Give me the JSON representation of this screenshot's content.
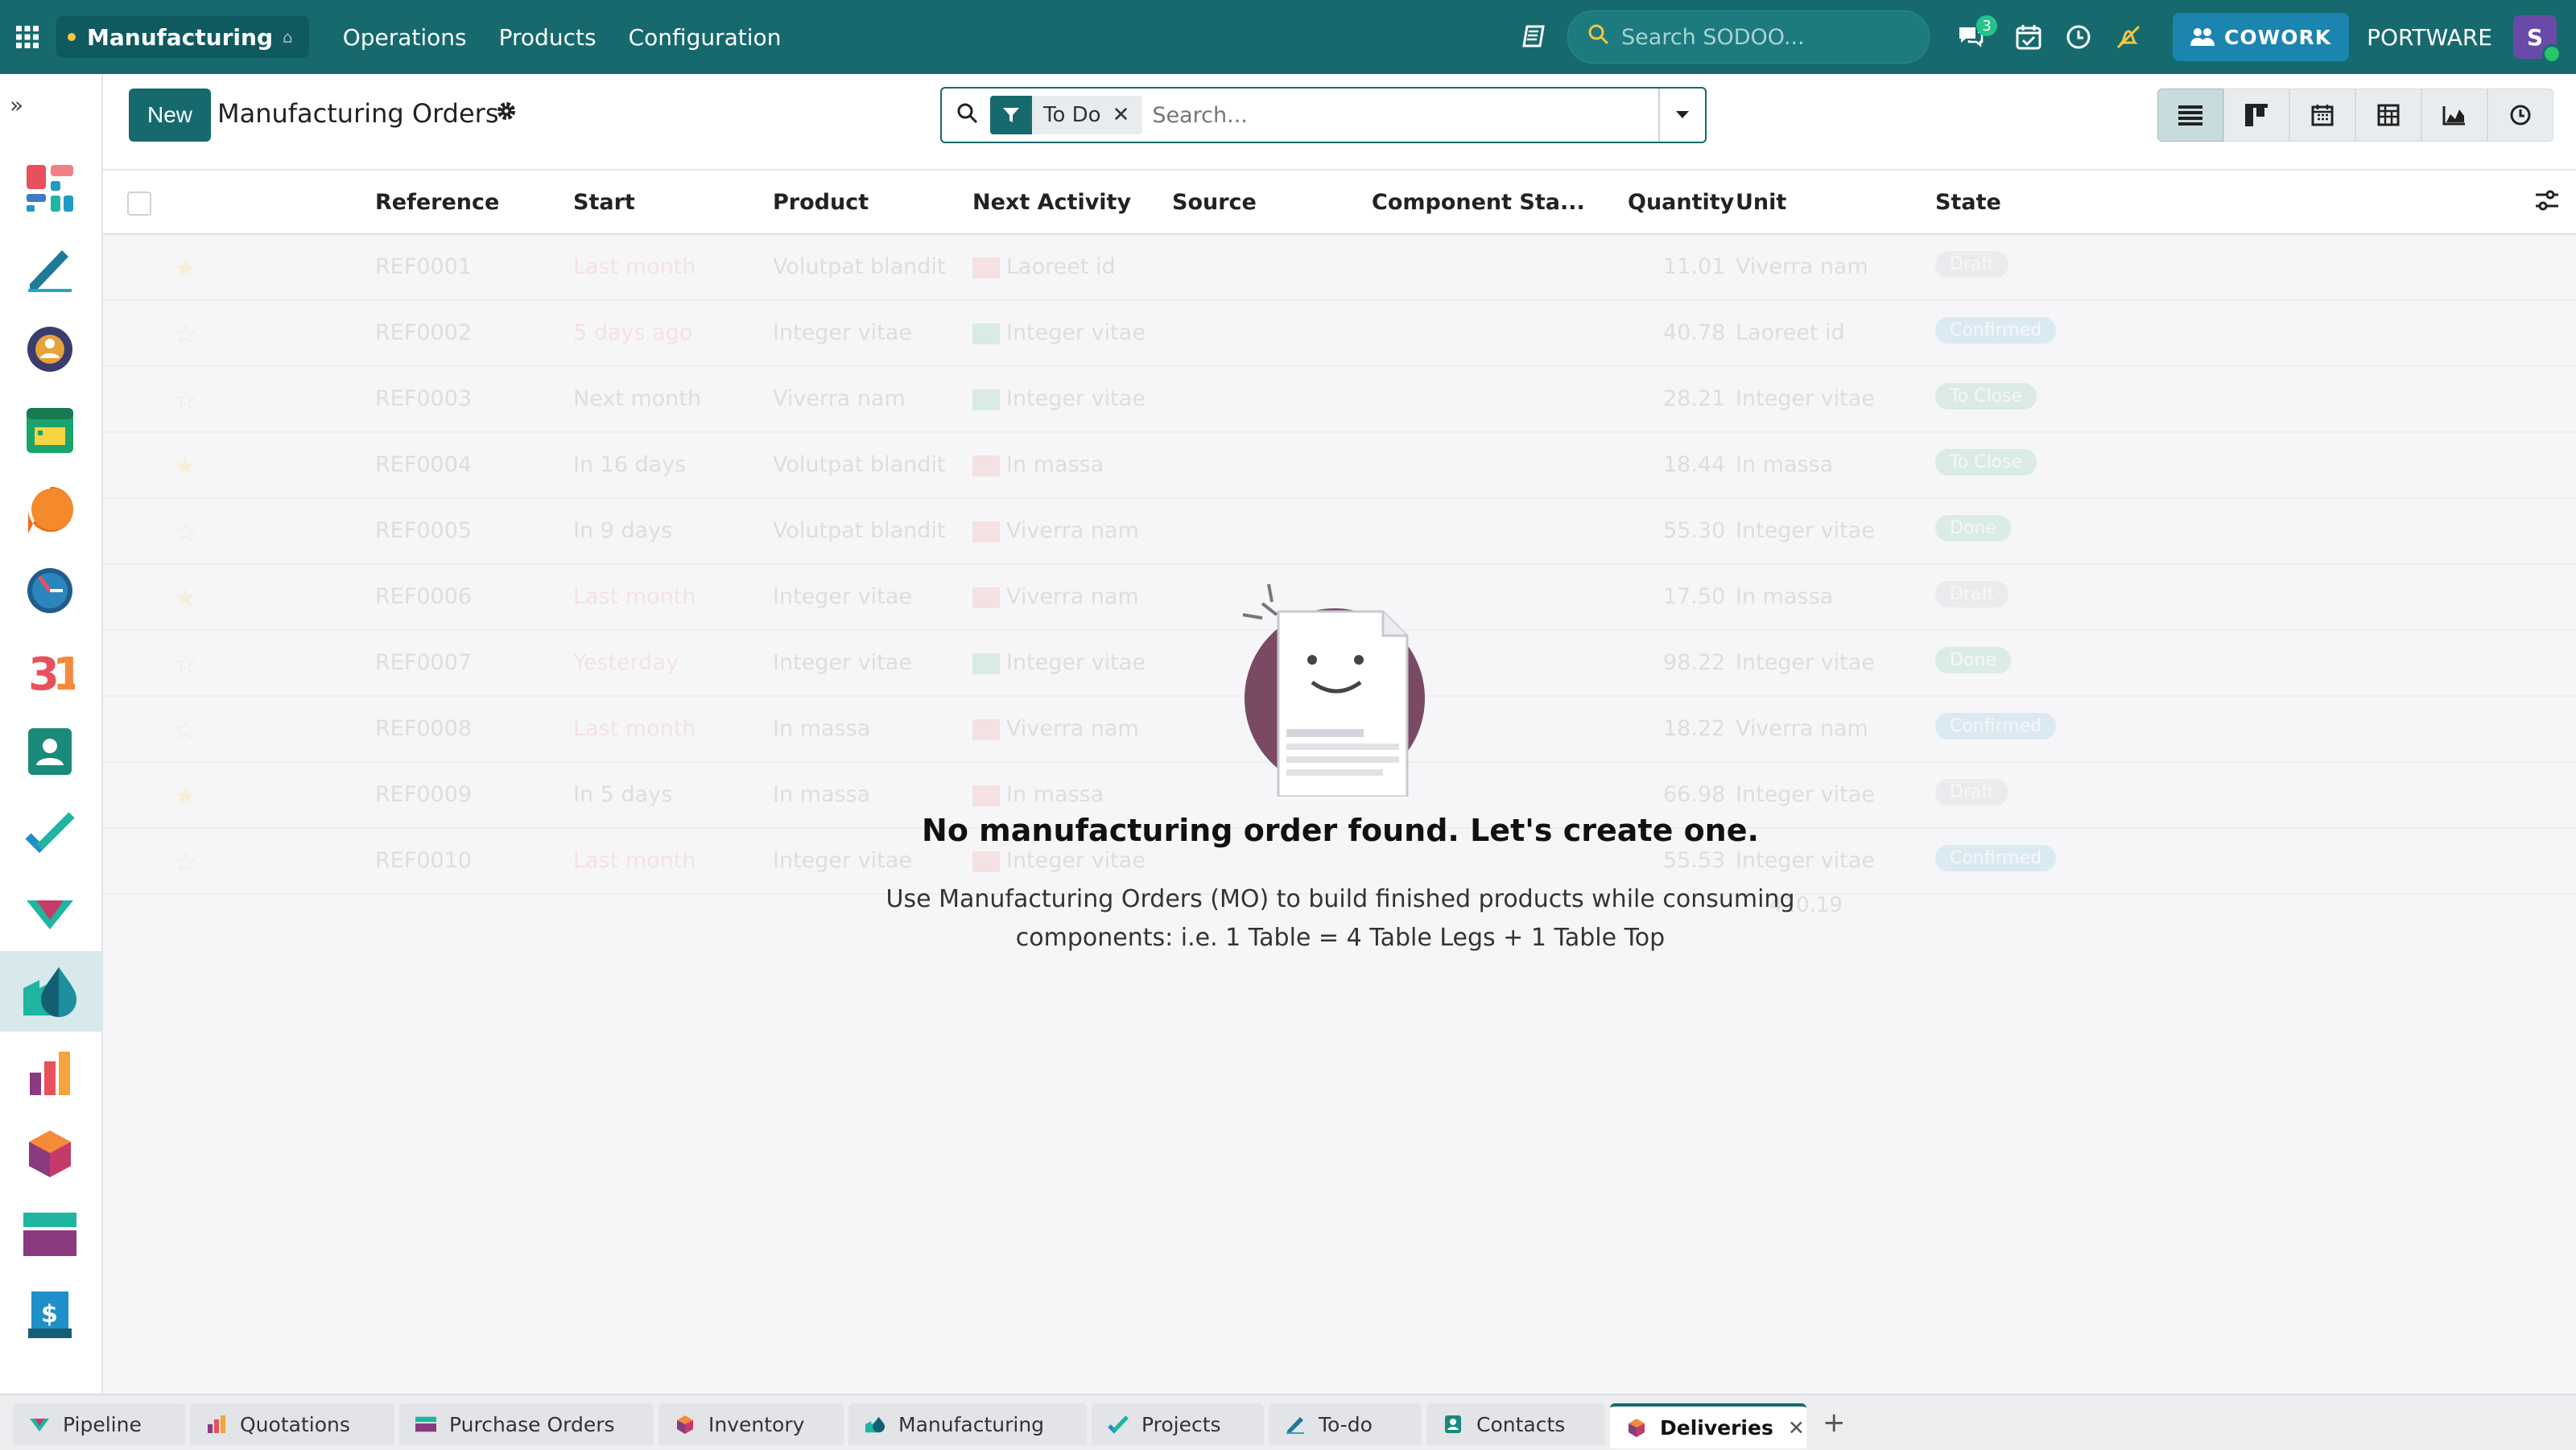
{
  "topbar": {
    "app_name": "Manufacturing",
    "menu": [
      "Operations",
      "Products",
      "Configuration"
    ],
    "search_placeholder": "Search SODOO...",
    "chat_badge": "3",
    "cowork_label": "COWORK",
    "company": "PORTWARE",
    "avatar_letter": "S"
  },
  "control": {
    "new_label": "New",
    "title": "Manufacturing Orders",
    "facet_label": "To Do",
    "search_placeholder": "Search..."
  },
  "table": {
    "columns": [
      "Reference",
      "Start",
      "Product",
      "Next Activity",
      "Source",
      "Component Sta...",
      "Quantity",
      "Unit",
      "State"
    ],
    "rows": [
      {
        "ref": "REF0001",
        "start": "Last month",
        "product": "Volutpat blandit",
        "activity": "Laoreet id",
        "qty": "11.01",
        "unit": "Viverra nam",
        "state": "Draft",
        "starred": true
      },
      {
        "ref": "REF0002",
        "start": "5 days ago",
        "product": "Integer vitae",
        "activity": "Integer vitae",
        "qty": "40.78",
        "unit": "Laoreet id",
        "state": "Confirmed",
        "starred": false
      },
      {
        "ref": "REF0003",
        "start": "Next month",
        "product": "Viverra nam",
        "activity": "Integer vitae",
        "qty": "28.21",
        "unit": "Integer vitae",
        "state": "To Close",
        "starred": false
      },
      {
        "ref": "REF0004",
        "start": "In 16 days",
        "product": "Volutpat blandit",
        "activity": "In massa",
        "qty": "18.44",
        "unit": "In massa",
        "state": "To Close",
        "starred": true
      },
      {
        "ref": "REF0005",
        "start": "In 9 days",
        "product": "Volutpat blandit",
        "activity": "Viverra nam",
        "qty": "55.30",
        "unit": "Integer vitae",
        "state": "Done",
        "starred": false
      },
      {
        "ref": "REF0006",
        "start": "Last month",
        "product": "Integer vitae",
        "activity": "Viverra nam",
        "qty": "17.50",
        "unit": "In massa",
        "state": "Draft",
        "starred": true
      },
      {
        "ref": "REF0007",
        "start": "Yesterday",
        "product": "Integer vitae",
        "activity": "Integer vitae",
        "qty": "98.22",
        "unit": "Integer vitae",
        "state": "Done",
        "starred": false
      },
      {
        "ref": "REF0008",
        "start": "Last month",
        "product": "In massa",
        "activity": "Viverra nam",
        "qty": "18.22",
        "unit": "Viverra nam",
        "state": "Confirmed",
        "starred": false
      },
      {
        "ref": "REF0009",
        "start": "In 5 days",
        "product": "In massa",
        "activity": "In massa",
        "qty": "66.98",
        "unit": "Integer vitae",
        "state": "Draft",
        "starred": true
      },
      {
        "ref": "REF0010",
        "start": "Last month",
        "product": "Integer vitae",
        "activity": "Integer vitae",
        "qty": "55.53",
        "unit": "Integer vitae",
        "state": "Confirmed",
        "starred": false
      }
    ],
    "total_qty": "410.19"
  },
  "empty_state": {
    "title": "No manufacturing order found. Let's create one.",
    "text": "Use Manufacturing Orders (MO) to build finished products while consuming components: i.e. 1 Table = 4 Table Legs + 1 Table Top"
  },
  "tabs": [
    {
      "label": "Pipeline",
      "icon": "pipeline-icon"
    },
    {
      "label": "Quotations",
      "icon": "quotations-icon"
    },
    {
      "label": "Purchase Orders",
      "icon": "purchase-icon"
    },
    {
      "label": "Inventory",
      "icon": "inventory-icon"
    },
    {
      "label": "Manufacturing",
      "icon": "manufacturing-icon"
    },
    {
      "label": "Projects",
      "icon": "projects-icon"
    },
    {
      "label": "To-do",
      "icon": "todo-icon"
    },
    {
      "label": "Contacts",
      "icon": "contacts-icon"
    },
    {
      "label": "Deliveries",
      "icon": "deliveries-icon",
      "active": true
    }
  ],
  "colors": {
    "brand": "#166a6e",
    "cowork": "#1b85b0",
    "star": "#f3c000"
  }
}
